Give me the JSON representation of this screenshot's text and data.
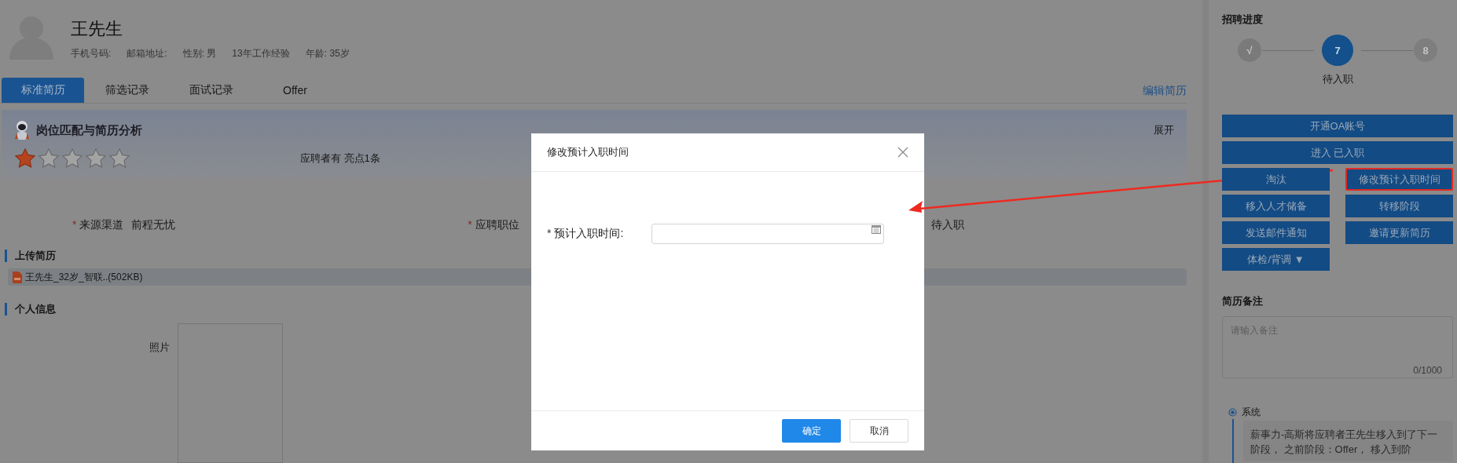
{
  "candidate": {
    "name": "王先生",
    "info": [
      "手机号码:",
      "邮箱地址:",
      "性别: 男",
      "13年工作经验",
      "年龄: 35岁"
    ]
  },
  "tabs": [
    {
      "label": "标准简历",
      "selected": true
    },
    {
      "label": "筛选记录",
      "selected": false
    },
    {
      "label": "面试记录",
      "selected": false
    },
    {
      "label": "Offer",
      "selected": false
    }
  ],
  "edit_link": "编辑简历",
  "analysis": {
    "title": "岗位匹配与简历分析",
    "expand": "展开",
    "stars": 1,
    "summary": "应聘者有 亮点1条"
  },
  "fields": [
    {
      "marker": "*",
      "label": "来源渠道",
      "value": "前程无忧"
    },
    {
      "marker": "*",
      "label": "应聘职位"
    },
    {
      "value": "待入职"
    }
  ],
  "upload_section": {
    "title": "上传简历",
    "file": "王先生_32岁_智联..(502KB)"
  },
  "personal_section": {
    "title": "个人信息",
    "photo_label": "照片"
  },
  "progress": {
    "title": "招聘进度",
    "steps": [
      {
        "mark": "√",
        "kind": "done"
      },
      {
        "mark": "7",
        "kind": "current",
        "label": "待入职"
      },
      {
        "mark": "8",
        "kind": "upcoming"
      }
    ]
  },
  "actions": [
    {
      "label": "开通OA账号",
      "kind": "wide",
      "highlighted": false
    },
    {
      "label": "进入 已入职",
      "kind": "wide",
      "highlighted": false
    },
    {
      "label": "淘汰",
      "kind": "half",
      "highlighted": false
    },
    {
      "label": "修改预计入职时间",
      "kind": "half",
      "highlighted": true
    },
    {
      "label": "移入人才储备",
      "kind": "half",
      "highlighted": false
    },
    {
      "label": "转移阶段",
      "kind": "half",
      "highlighted": false
    },
    {
      "label": "发送邮件通知",
      "kind": "half",
      "highlighted": false
    },
    {
      "label": "邀请更新简历",
      "kind": "half",
      "highlighted": false
    },
    {
      "label": "体检/背调 ▼",
      "kind": "half",
      "highlighted": false
    }
  ],
  "notes": {
    "title": "简历备注",
    "placeholder": "请输入备注",
    "counter": "0/1000"
  },
  "timeline": [
    {
      "author": "系统",
      "text": "薪事力-高斯将应聘者王先生移入到了下一阶段， 之前阶段：Offer， 移入到阶"
    }
  ],
  "dialog": {
    "title": "修改预计入职时间",
    "field": {
      "marker": "*",
      "label": "预计入职时间:"
    },
    "buttons": [
      {
        "label": "确定",
        "kind": "primary"
      },
      {
        "label": "取消",
        "kind": "default"
      }
    ]
  }
}
